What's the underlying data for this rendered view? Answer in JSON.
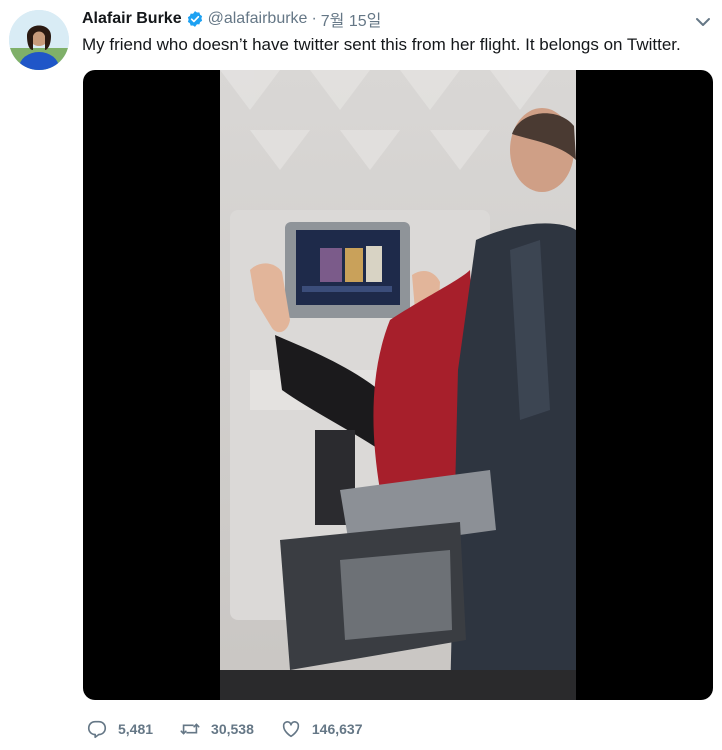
{
  "tweet": {
    "author_name": "Alafair Burke",
    "handle": "@alafairburke",
    "separator": "·",
    "date": "7월 15일",
    "text": "My friend who doesn’t have twitter sent this from her flight. It belongs on Twitter.",
    "verified": true
  },
  "media": {
    "type": "video",
    "icon": "video-frame"
  },
  "actions": {
    "replies": "5,481",
    "retweets": "30,538",
    "likes": "146,637"
  },
  "colors": {
    "muted": "#657786",
    "verified_blue": "#1da1f2",
    "text": "#14171a"
  }
}
